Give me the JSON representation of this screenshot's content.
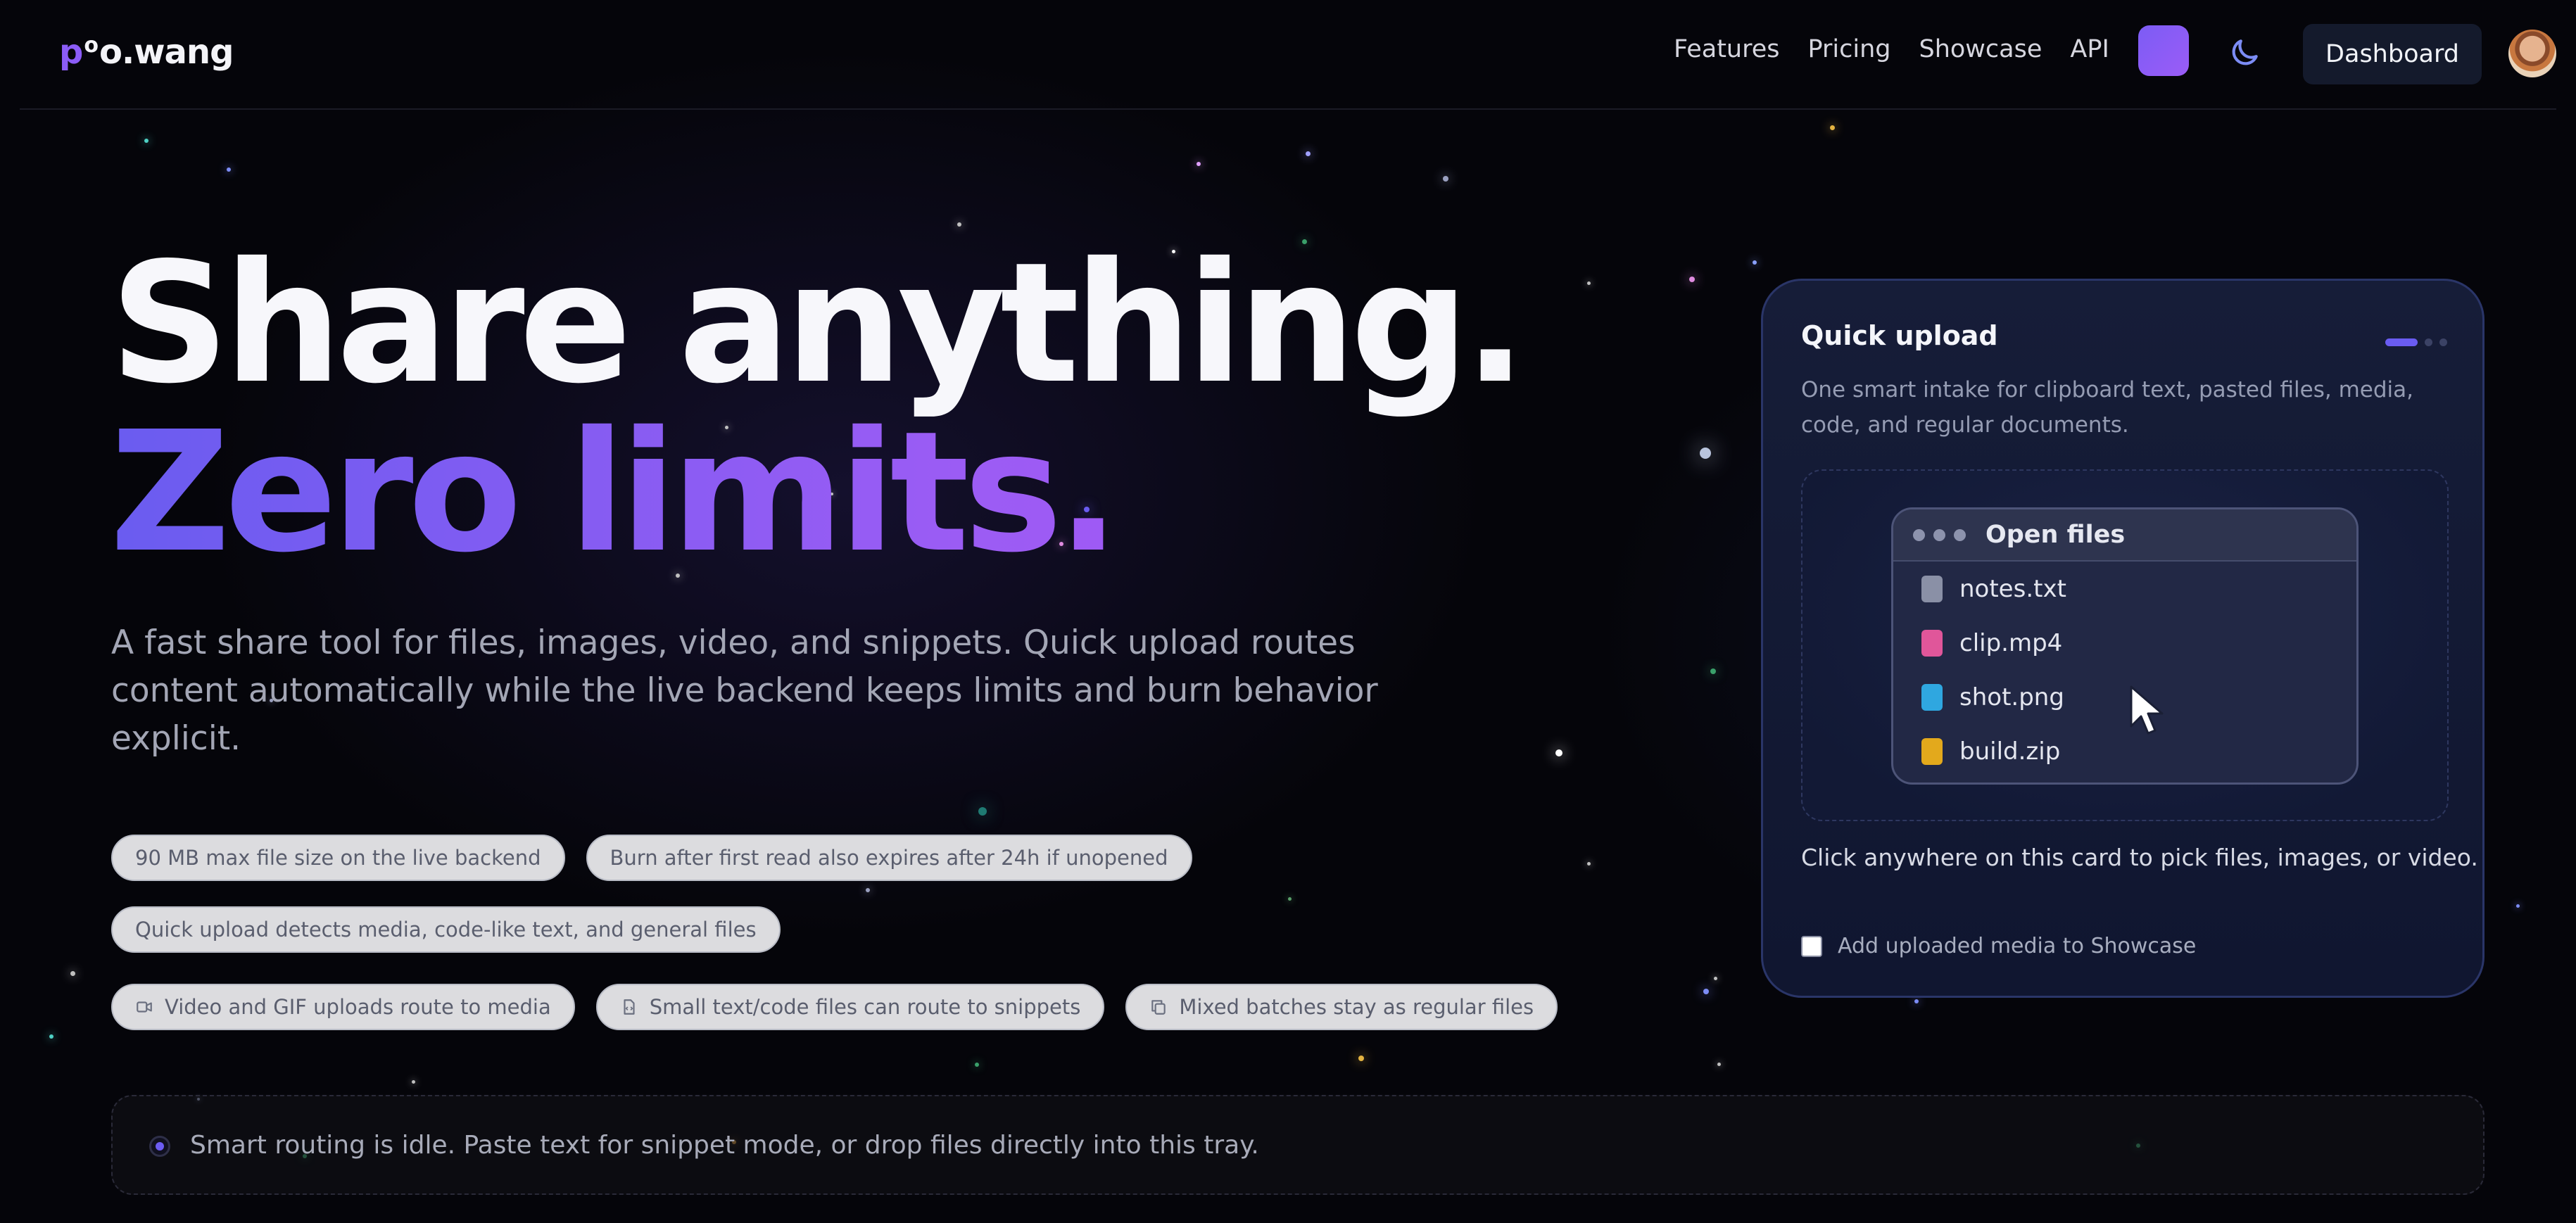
{
  "brand": {
    "logo_p": "p",
    "logo_o": "o",
    "logo_rest": "o.wang"
  },
  "nav": {
    "items": [
      "Features",
      "Pricing",
      "Showcase",
      "API"
    ],
    "dashboard_label": "Dashboard"
  },
  "hero": {
    "title_line1": "Share anything.",
    "title_line2": "Zero limits.",
    "lead": "A fast share tool for files, images, video, and snippets. Quick upload routes content automatically while the live backend keeps limits and burn behavior explicit."
  },
  "pills": {
    "row1": [
      "90 MB max file size on the live backend",
      "Burn after first read also expires after 24h if unopened"
    ],
    "row2": [
      "Quick upload detects media, code-like text, and general files"
    ],
    "row3": [
      {
        "icon": "video-icon",
        "label": "Video and GIF uploads route to media"
      },
      {
        "icon": "file-code-icon",
        "label": "Small text/code files can route to snippets"
      },
      {
        "icon": "copy-icon",
        "label": "Mixed batches stay as regular files"
      }
    ]
  },
  "status": {
    "text": "Smart routing is idle. Paste text for snippet mode, or drop files directly into this tray."
  },
  "upload_card": {
    "title": "Quick upload",
    "description": "One smart intake for clipboard text, pasted files, media, code, and regular documents.",
    "window_title": "Open files",
    "files": [
      {
        "name": "notes.txt",
        "color": "#8a90a6"
      },
      {
        "name": "clip.mp4",
        "color": "#e0569a"
      },
      {
        "name": "shot.png",
        "color": "#2fa7e0"
      },
      {
        "name": "build.zip",
        "color": "#e3a91c"
      }
    ],
    "hint": "Click anywhere on this card to pick files, images, or video.",
    "showcase_label": "Add uploaded media to Showcase"
  },
  "colors": {
    "accent": "#7c5cf5",
    "background": "#05050a",
    "card": "#141b36"
  }
}
